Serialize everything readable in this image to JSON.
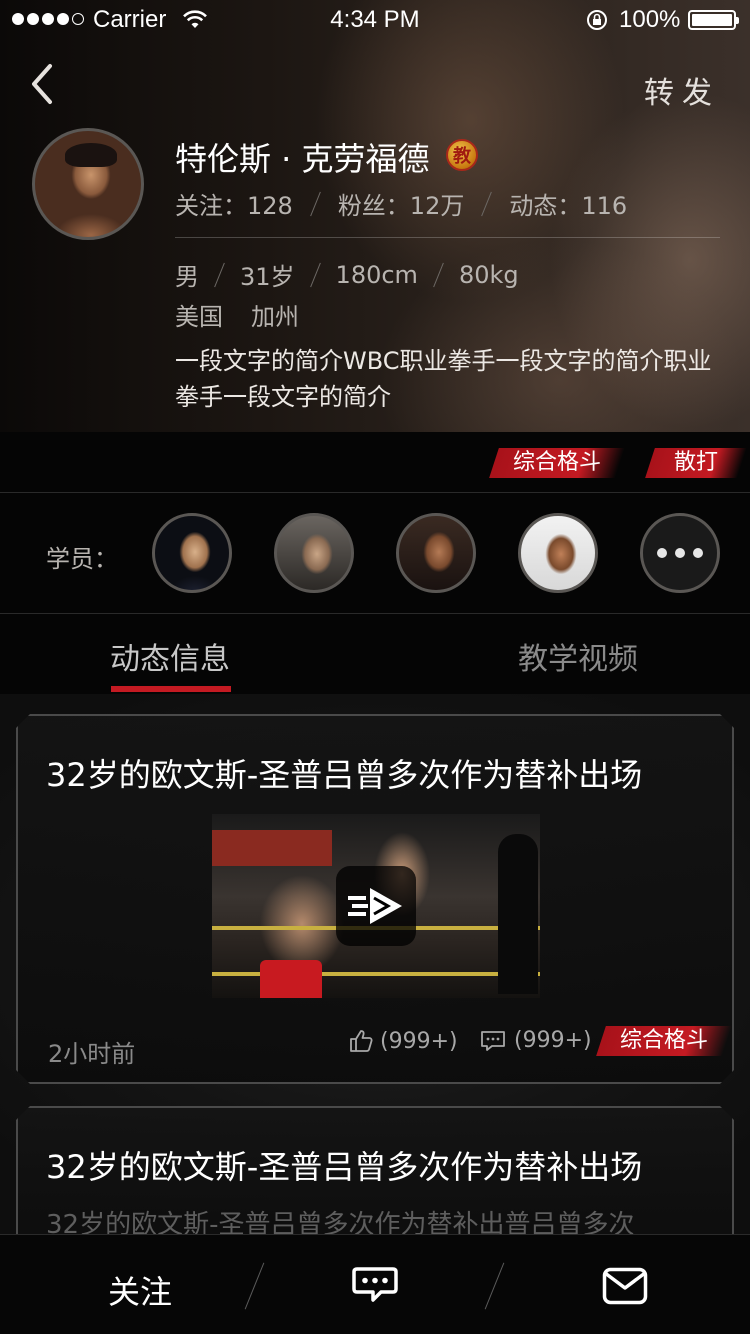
{
  "status_bar": {
    "carrier": "Carrier",
    "time": "4:34 PM",
    "battery": "100%"
  },
  "header": {
    "share_label": "转发"
  },
  "profile": {
    "name": "特伦斯 · 克劳福德",
    "badge": "教",
    "stats": {
      "follow": "关注：128",
      "fans": "粉丝：12万",
      "posts": "动态：116"
    },
    "gender": "男",
    "age": "31岁",
    "height": "180cm",
    "weight": "80kg",
    "country": "美国",
    "region": "加州",
    "bio": "一段文字的简介WBC职业拳手一段文字的简介职业拳手一段文字的简介",
    "tags": [
      "综合格斗",
      "散打"
    ]
  },
  "students": {
    "label": "学员："
  },
  "tabs": {
    "active": "动态信息",
    "inactive": "教学视频"
  },
  "feed": [
    {
      "title": "32岁的欧文斯-圣普吕曾多次作为替补出场",
      "time": "2小时前",
      "likes": "(999+)",
      "comments": "(999+)",
      "tag": "综合格斗"
    },
    {
      "title": "32岁的欧文斯-圣普吕曾多次作为替补出场",
      "subtitle": "32岁的欧文斯-圣普吕曾多次作为替补出普吕曾多次"
    }
  ],
  "bottom_bar": {
    "follow": "关注"
  },
  "colors": {
    "accent": "#c41a22",
    "background": "#000000"
  },
  "icons": [
    "back-icon",
    "wifi-icon",
    "lock-rotation-icon",
    "battery-icon",
    "coach-badge-icon",
    "more-icon",
    "play-icon",
    "like-icon",
    "comment-icon",
    "chat-icon",
    "mail-icon"
  ]
}
